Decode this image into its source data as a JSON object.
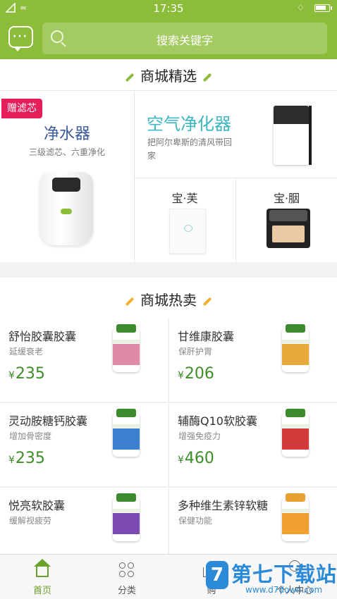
{
  "status_bar": {
    "time": "17:35"
  },
  "header": {
    "search_placeholder": "搜索关键字"
  },
  "featured": {
    "title": "商城精选",
    "purifier": {
      "tag": "赠滤芯",
      "title": "净水器",
      "subtitle": "三级滤芯、六重净化"
    },
    "air": {
      "title": "空气净化器",
      "subtitle": "把阿尔卑斯的清风带回家"
    },
    "small1": {
      "title": "宝·芙"
    },
    "small2": {
      "title": "宝·胭"
    }
  },
  "hot": {
    "title": "商城热卖",
    "products": [
      {
        "name": "舒怡胶囊胶囊",
        "desc": "延缓衰老",
        "currency": "¥",
        "price": "235",
        "label_color": "#e08aa8"
      },
      {
        "name": "甘维康胶囊",
        "desc": "保肝护胃",
        "currency": "¥",
        "price": "206",
        "label_color": "#e6a93a"
      },
      {
        "name": "灵动胺糖钙胶囊",
        "desc": "增加骨密度",
        "currency": "¥",
        "price": "235",
        "label_color": "#3a7fd0"
      },
      {
        "name": "辅酶Q10软胶囊",
        "desc": "增强免疫力",
        "currency": "¥",
        "price": "460",
        "label_color": "#d43a3a"
      },
      {
        "name": "悦亮软胶囊",
        "desc": "缓解视疲劳",
        "currency": "¥",
        "price": "",
        "label_color": "#7a4ab0"
      },
      {
        "name": "多种维生素锌软糖",
        "desc": "保健功能",
        "currency": "¥",
        "price": "",
        "label_color": "#f0a030"
      }
    ]
  },
  "tabs": [
    {
      "label": "首页",
      "icon": "home-icon"
    },
    {
      "label": "分类",
      "icon": "category-icon"
    },
    {
      "label": "购",
      "icon": "cart-icon"
    },
    {
      "label": "个人中心",
      "icon": "user-icon"
    }
  ],
  "watermark": {
    "text": "第七下载站",
    "url": "www.d7down.com",
    "badge": "7"
  },
  "colors": {
    "brand_green": "#8cbd3a",
    "price_green": "#3d8d28",
    "tag_red": "#e61e5a"
  }
}
